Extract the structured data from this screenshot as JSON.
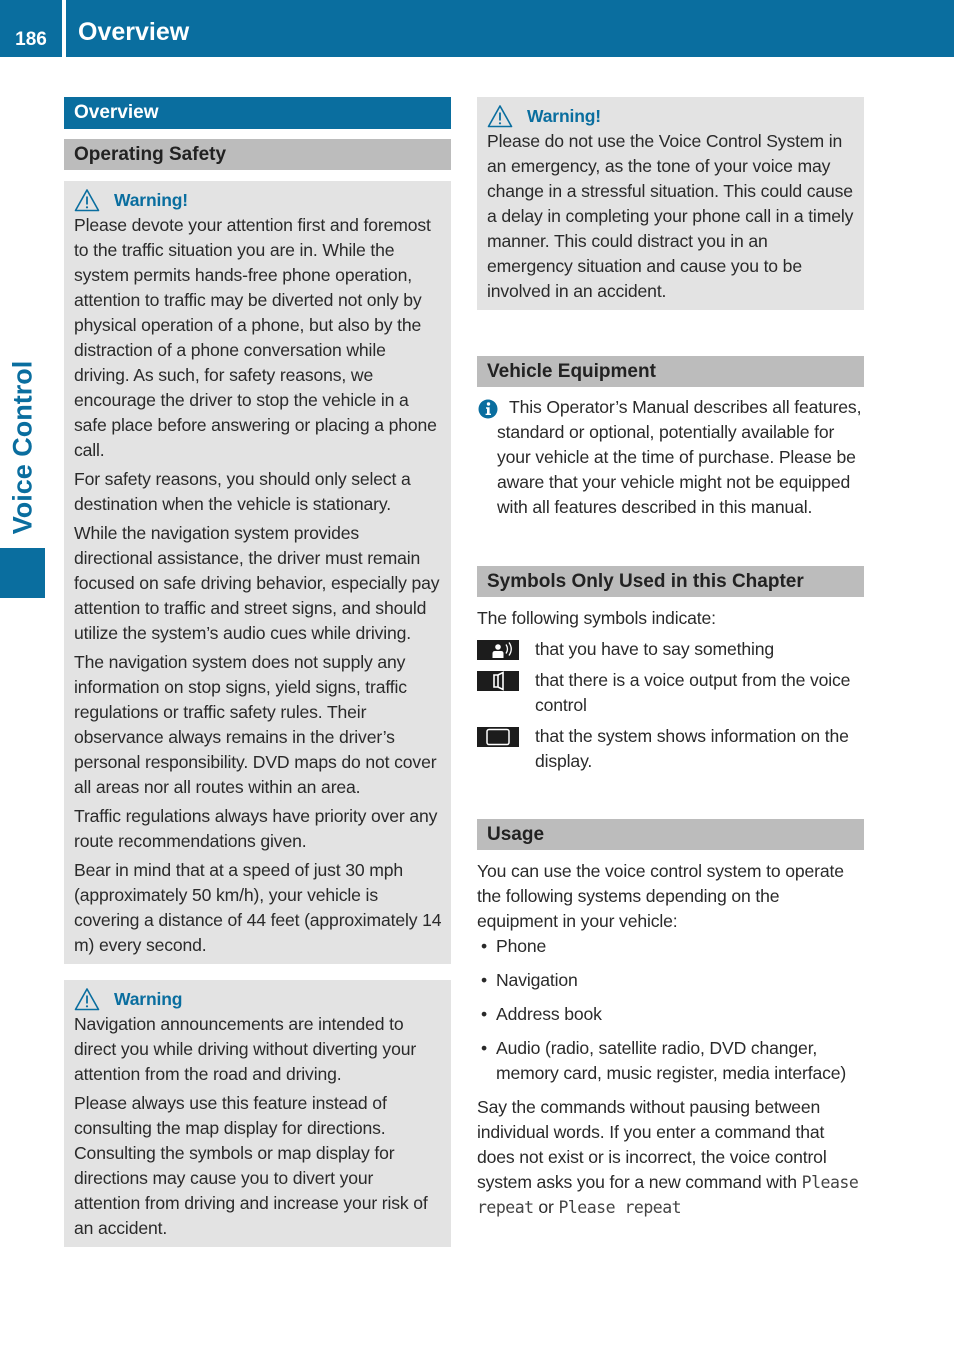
{
  "header": {
    "page_number": "186",
    "title": "Overview"
  },
  "side_tab": {
    "label": "Voice Control"
  },
  "colors": {
    "brand_blue": "#0a6e9f",
    "section_grey": "#bcbcbc",
    "box_grey": "#e3e3e3"
  },
  "left": {
    "section_heading": "Overview",
    "subsection_heading": "Operating Safety",
    "warning1": {
      "icon": "warning-triangle-icon",
      "title": "Warning!",
      "paragraphs": [
        "Please devote your attention first and foremost to the traffic situation you are in. While the system permits hands-free phone operation, attention to traffic may be diverted not only by physical operation of a phone, but also by the distraction of a phone conversation while driving. As such, for safety reasons, we encourage the driver to stop the vehicle in a safe place before answering or placing a phone call.",
        "For safety reasons, you should only select a destination when the vehicle is stationary.",
        "While the navigation system provides directional assistance, the driver must remain focused on safe driving behavior, especially pay attention to traffic and street signs, and should utilize the system’s audio cues while driving.",
        "The navigation system does not supply any information on stop signs, yield signs, traffic regulations or traffic safety rules. Their observance always remains in the driver’s personal responsibility. DVD maps do not cover all areas nor all routes within an area.",
        "Traffic regulations always have priority over any route recommendations given.",
        "Bear in mind that at a speed of just 30 mph (approximately 50 km/h), your vehicle is covering a distance of 44 feet (approximately 14 m) every second."
      ]
    },
    "warning2": {
      "icon": "warning-triangle-icon",
      "title": "Warning",
      "paragraphs": [
        "Navigation announcements are intended to direct you while driving without diverting your attention from the road and driving.",
        "Please always use this feature instead of consulting the map display for directions. Consulting the symbols or map display for directions may cause you to divert your attention from driving and increase your risk of an accident."
      ]
    }
  },
  "right": {
    "warning3": {
      "icon": "warning-triangle-icon",
      "title": "Warning!",
      "paragraphs": [
        "Please do not use the Voice Control System in an emergency, as the tone of your voice may change in a stressful situation. This could cause a delay in completing your phone call in a timely manner. This could distract you in an emergency situation and cause you to be involved in an accident."
      ]
    },
    "vehicle_equipment": {
      "heading": "Vehicle Equipment",
      "info_icon": "info-icon",
      "text": "This Operator’s Manual describes all features, standard or optional, potentially available for your vehicle at the time of purchase. Please be aware that your vehicle might not be equipped with all features described in this manual."
    },
    "symbols": {
      "heading": "Symbols Only Used in this Chapter",
      "intro": "The following symbols indicate:",
      "items": [
        {
          "icon": "speak-person-icon",
          "label": "that you have to say something"
        },
        {
          "icon": "speaker-output-icon",
          "label": "that there is a voice output from the voice control"
        },
        {
          "icon": "display-screen-icon",
          "label": "that the system shows information on the display."
        }
      ]
    },
    "usage": {
      "heading": "Usage",
      "intro": "You can use the voice control system to operate the following systems depending on the equipment in your vehicle:",
      "bullets": [
        "Phone",
        "Navigation",
        "Address book",
        "Audio (radio, satellite radio, DVD changer, memory card, music register, media interface)"
      ],
      "para_before": "Say the commands without pausing between individual words. If you enter a command that does not exist or is incorrect, the voice control system asks you for a new command with ",
      "command1": "Please repeat",
      "or_word": " or ",
      "command2": "Please repeat"
    }
  }
}
